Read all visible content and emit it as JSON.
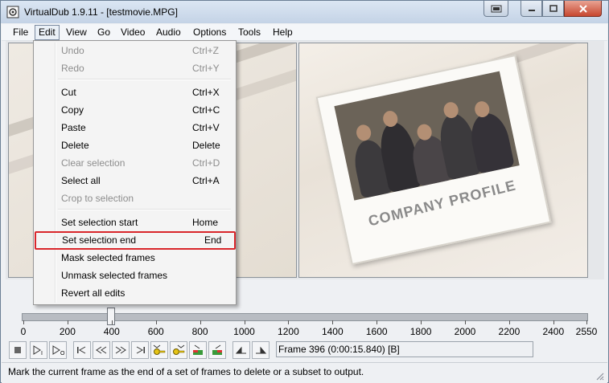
{
  "window": {
    "title": "VirtualDub 1.9.11 - [testmovie.MPG]"
  },
  "menubar": {
    "items": [
      {
        "label": "File",
        "accel": "F"
      },
      {
        "label": "Edit",
        "accel": "E"
      },
      {
        "label": "View",
        "accel": "V"
      },
      {
        "label": "Go",
        "accel": "G"
      },
      {
        "label": "Video",
        "accel": "V"
      },
      {
        "label": "Audio",
        "accel": "A"
      },
      {
        "label": "Options",
        "accel": "O"
      },
      {
        "label": "Tools",
        "accel": "T"
      },
      {
        "label": "Help",
        "accel": "H"
      }
    ]
  },
  "edit_menu": {
    "items": [
      {
        "label": "Undo",
        "shortcut": "Ctrl+Z",
        "enabled": false
      },
      {
        "label": "Redo",
        "shortcut": "Ctrl+Y",
        "enabled": false
      },
      {
        "label": "Cut",
        "shortcut": "Ctrl+X",
        "enabled": true
      },
      {
        "label": "Copy",
        "shortcut": "Ctrl+C",
        "enabled": true
      },
      {
        "label": "Paste",
        "shortcut": "Ctrl+V",
        "enabled": true
      },
      {
        "label": "Delete",
        "shortcut": "Delete",
        "enabled": true
      },
      {
        "label": "Clear selection",
        "shortcut": "Ctrl+D",
        "enabled": false
      },
      {
        "label": "Select all",
        "shortcut": "Ctrl+A",
        "enabled": true
      },
      {
        "label": "Crop to selection",
        "shortcut": "",
        "enabled": false
      },
      {
        "label": "Set selection start",
        "shortcut": "Home",
        "enabled": true
      },
      {
        "label": "Set selection end",
        "shortcut": "End",
        "enabled": true,
        "highlighted": true
      },
      {
        "label": "Mask selected frames",
        "shortcut": "",
        "enabled": true
      },
      {
        "label": "Unmask selected frames",
        "shortcut": "",
        "enabled": true
      },
      {
        "label": "Revert all edits",
        "shortcut": "",
        "enabled": true
      }
    ]
  },
  "preview": {
    "caption": "COMPANY PROFILE"
  },
  "timeline": {
    "ticks": [
      "0",
      "200",
      "400",
      "600",
      "800",
      "1000",
      "1200",
      "1400",
      "1600",
      "1800",
      "2000",
      "2200",
      "2400",
      "2550"
    ],
    "current_frame": 396,
    "total_frames": 2550
  },
  "toolbar": {
    "icons": [
      "stop-icon",
      "play-input-icon",
      "play-output-icon",
      "go-start-icon",
      "prev-frame-icon",
      "next-frame-icon",
      "go-end-icon",
      "prev-keyframe-icon",
      "next-keyframe-icon",
      "scene-back-icon",
      "scene-forward-icon",
      "mark-in-icon",
      "mark-out-icon"
    ]
  },
  "frame_readout": {
    "text": "Frame 396 (0:00:15.840) [B]"
  },
  "status": {
    "text": "Mark the current frame as the end of a set of frames to delete or a subset to output."
  },
  "colors": {
    "highlight_border": "#d9262b",
    "close_button": "#c7472f"
  }
}
